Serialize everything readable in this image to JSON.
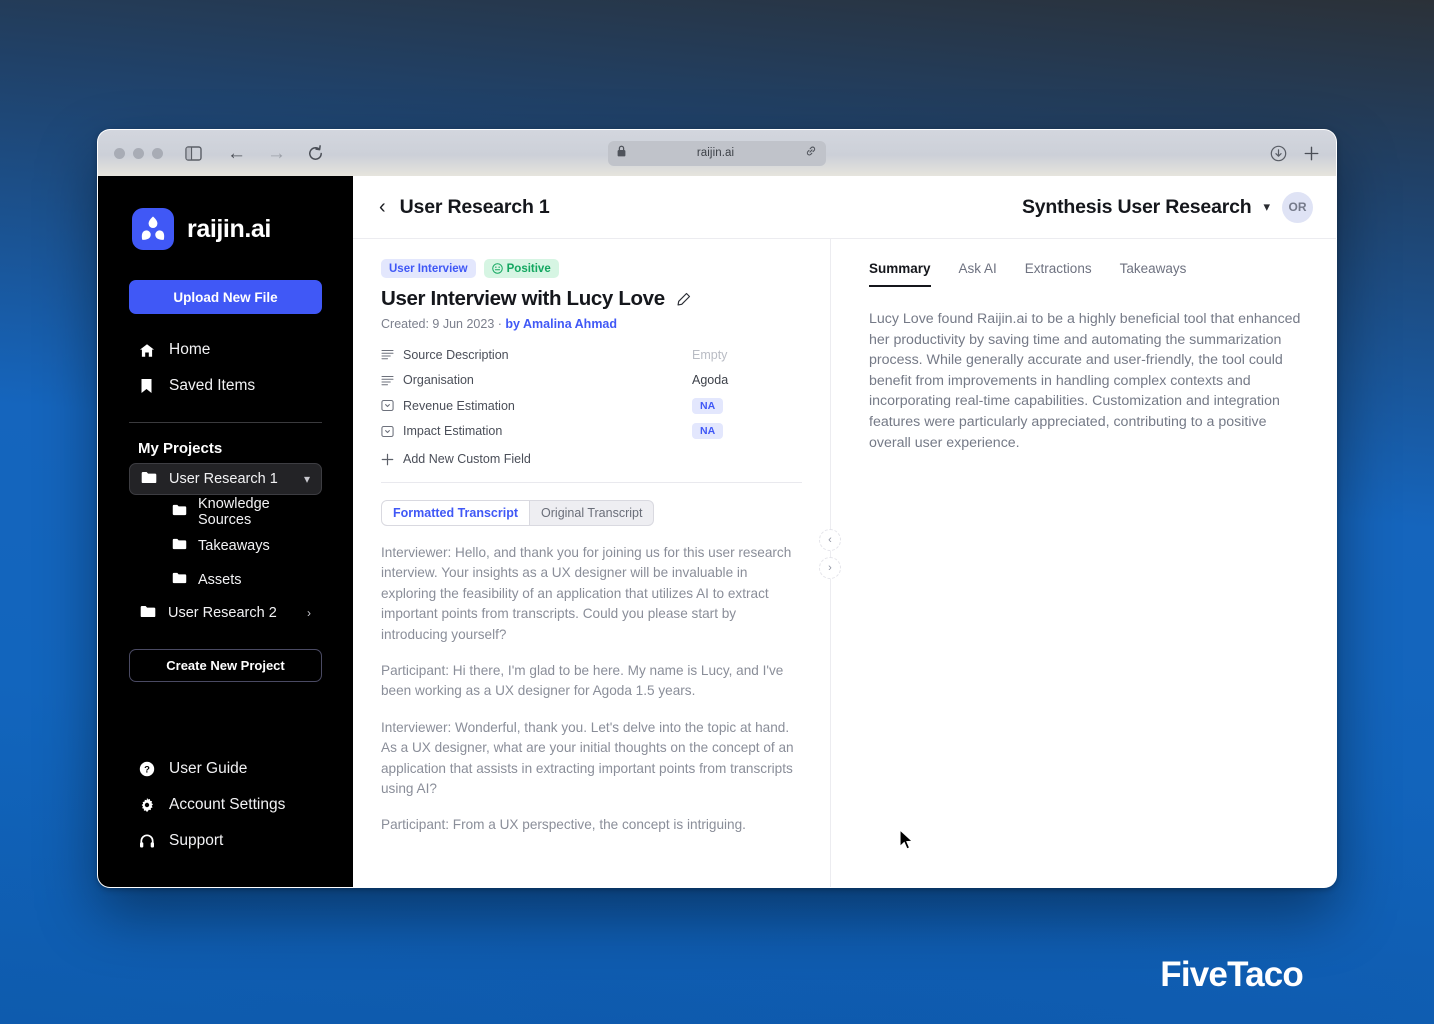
{
  "browser": {
    "url": "raijin.ai",
    "lock_icon": "lock-icon",
    "link_icon": "link-icon",
    "sidebar_toggle_icon": "sidebar-toggle-icon",
    "back_icon": "back-arrow-icon",
    "forward_icon": "forward-arrow-icon",
    "reload_icon": "reload-icon",
    "download_icon": "download-icon",
    "new_tab_icon": "plus-icon"
  },
  "sidebar": {
    "brand_name": "raijin.ai",
    "logo_icon": "raijin-logo-icon",
    "upload_label": "Upload New File",
    "nav": [
      {
        "label": "Home",
        "icon": "home-icon"
      },
      {
        "label": "Saved Items",
        "icon": "bookmark-icon"
      }
    ],
    "projects_title": "My Projects",
    "projects": [
      {
        "label": "User Research 1",
        "icon": "folder-icon",
        "chevron": "chevron-down-icon",
        "active": true
      },
      {
        "label": "User Research 2",
        "icon": "folder-icon",
        "chevron": "chevron-right-icon",
        "active": false
      }
    ],
    "sub_items": [
      {
        "label": "Knowledge Sources",
        "icon": "folder-icon"
      },
      {
        "label": "Takeaways",
        "icon": "folder-icon"
      },
      {
        "label": "Assets",
        "icon": "folder-icon"
      }
    ],
    "create_label": "Create New Project",
    "bottom_nav": [
      {
        "label": "User Guide",
        "icon": "help-circle-icon"
      },
      {
        "label": "Account Settings",
        "icon": "gear-icon"
      },
      {
        "label": "Support",
        "icon": "headset-icon"
      }
    ]
  },
  "header": {
    "back_icon": "chevron-left-icon",
    "title": "User Research 1",
    "workspace": "Synthesis User Research",
    "workspace_chevron": "chevron-down-icon",
    "avatar_initials": "OR"
  },
  "document": {
    "badge_type": "User Interview",
    "badge_sentiment": "Positive",
    "sentiment_icon": "smiley-face-icon",
    "title": "User Interview with Lucy Love",
    "edit_icon": "pencil-icon",
    "created_label": "Created: 9 Jun 2023",
    "meta_separator": "·",
    "author": "by Amalina Ahmad",
    "fields": [
      {
        "label": "Source Description",
        "value": "Empty",
        "value_style": "empty",
        "icon": "text-lines-icon"
      },
      {
        "label": "Organisation",
        "value": "Agoda",
        "value_style": "plain",
        "icon": "text-lines-icon"
      },
      {
        "label": "Revenue Estimation",
        "value": "NA",
        "value_style": "pill",
        "icon": "select-box-icon"
      },
      {
        "label": "Impact Estimation",
        "value": "NA",
        "value_style": "pill",
        "icon": "select-box-icon"
      }
    ],
    "add_field_label": "Add New Custom Field",
    "add_field_icon": "plus-icon",
    "transcript_tabs": [
      {
        "label": "Formatted Transcript",
        "active": true
      },
      {
        "label": "Original Transcript",
        "active": false
      }
    ],
    "transcript": [
      "Interviewer: Hello, and thank you for joining us for this user research interview. Your insights as a UX designer will be invaluable in exploring the feasibility of an application that utilizes AI to extract important points from transcripts. Could you please start by introducing yourself?",
      "Participant: Hi there, I'm glad to be here. My name is Lucy, and I've been working as a UX designer for Agoda 1.5 years.",
      "Interviewer: Wonderful, thank you. Let's delve into the topic at hand. As a UX designer, what are your initial thoughts on the concept of an application that assists in extracting important points from transcripts using AI?",
      "Participant: From a UX perspective, the concept is intriguing."
    ]
  },
  "panel_handles": {
    "prev_icon": "chevron-left-icon",
    "next_icon": "chevron-right-icon"
  },
  "right_panel": {
    "tabs": [
      {
        "label": "Summary",
        "active": true
      },
      {
        "label": "Ask AI",
        "active": false
      },
      {
        "label": "Extractions",
        "active": false
      },
      {
        "label": "Takeaways",
        "active": false
      }
    ],
    "summary": "Lucy Love found Raijin.ai to be a highly beneficial tool that enhanced her productivity by saving time and automating the summarization process. While generally accurate and user-friendly, the tool could benefit from improvements in handling complex contexts and incorporating real-time capabilities. Customization and integration features were particularly appreciated, contributing to a positive overall user experience."
  },
  "watermark": "FiveTaco",
  "colors": {
    "accent": "#4058f6",
    "sentiment_green": "#13a760",
    "desktop_blue": "#1565bd",
    "sidebar_black": "#000000"
  }
}
